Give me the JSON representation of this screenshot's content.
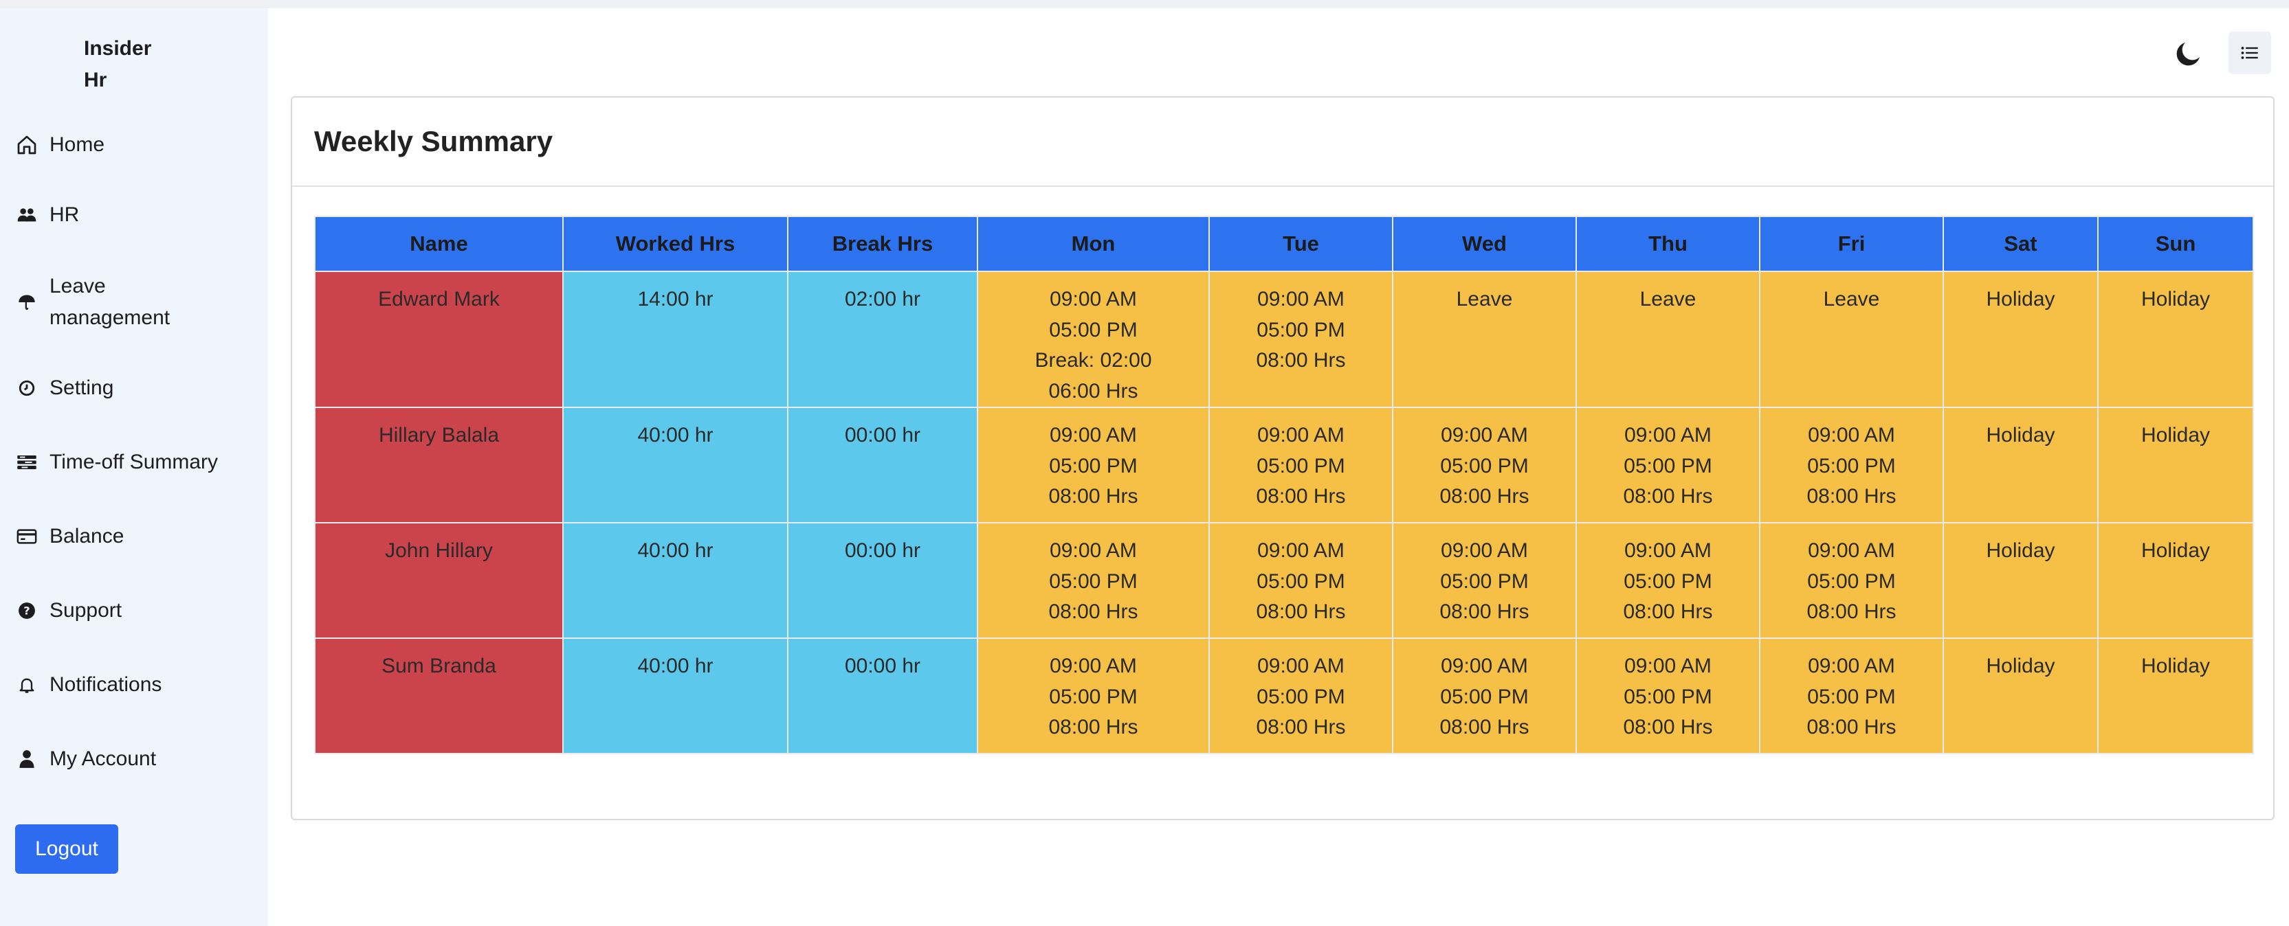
{
  "app": {
    "brand_line1": "Insider",
    "brand_line2": "Hr"
  },
  "sidebar": {
    "items": [
      {
        "label": "Home",
        "icon": "home-icon"
      },
      {
        "label": "HR",
        "icon": "users-icon"
      },
      {
        "label": "Leave management",
        "icon": "umbrella-icon"
      },
      {
        "label": "Setting",
        "icon": "clock-icon"
      },
      {
        "label": "Time-off Summary",
        "icon": "list-icon"
      },
      {
        "label": "Balance",
        "icon": "credit-card-icon"
      },
      {
        "label": "Support",
        "icon": "question-circle-icon"
      },
      {
        "label": "Notifications",
        "icon": "bell-icon"
      },
      {
        "label": "My Account",
        "icon": "user-icon"
      }
    ],
    "logout_label": "Logout"
  },
  "topbar": {
    "theme_icon": "moon-icon",
    "menu_icon": "list-menu-icon"
  },
  "card": {
    "title": "Weekly Summary"
  },
  "table": {
    "headers": [
      "Name",
      "Worked Hrs",
      "Break Hrs",
      "Mon",
      "Tue",
      "Wed",
      "Thu",
      "Fri",
      "Sat",
      "Sun"
    ],
    "rows": [
      {
        "name": "Edward Mark",
        "worked": "14:00 hr",
        "break": "02:00 hr",
        "days": [
          [
            "09:00 AM",
            "05:00 PM",
            "Break: 02:00",
            "06:00 Hrs"
          ],
          [
            "09:00 AM",
            "05:00 PM",
            "08:00 Hrs"
          ],
          [
            "Leave"
          ],
          [
            "Leave"
          ],
          [
            "Leave"
          ],
          [
            "Holiday"
          ],
          [
            "Holiday"
          ]
        ]
      },
      {
        "name": "Hillary Balala",
        "worked": "40:00 hr",
        "break": "00:00 hr",
        "days": [
          [
            "09:00 AM",
            "05:00 PM",
            "08:00 Hrs"
          ],
          [
            "09:00 AM",
            "05:00 PM",
            "08:00 Hrs"
          ],
          [
            "09:00 AM",
            "05:00 PM",
            "08:00 Hrs"
          ],
          [
            "09:00 AM",
            "05:00 PM",
            "08:00 Hrs"
          ],
          [
            "09:00 AM",
            "05:00 PM",
            "08:00 Hrs"
          ],
          [
            "Holiday"
          ],
          [
            "Holiday"
          ]
        ]
      },
      {
        "name": "John Hillary",
        "worked": "40:00 hr",
        "break": "00:00 hr",
        "days": [
          [
            "09:00 AM",
            "05:00 PM",
            "08:00 Hrs"
          ],
          [
            "09:00 AM",
            "05:00 PM",
            "08:00 Hrs"
          ],
          [
            "09:00 AM",
            "05:00 PM",
            "08:00 Hrs"
          ],
          [
            "09:00 AM",
            "05:00 PM",
            "08:00 Hrs"
          ],
          [
            "09:00 AM",
            "05:00 PM",
            "08:00 Hrs"
          ],
          [
            "Holiday"
          ],
          [
            "Holiday"
          ]
        ]
      },
      {
        "name": "Sum Branda",
        "worked": "40:00 hr",
        "break": "00:00 hr",
        "days": [
          [
            "09:00 AM",
            "05:00 PM",
            "08:00 Hrs"
          ],
          [
            "09:00 AM",
            "05:00 PM",
            "08:00 Hrs"
          ],
          [
            "09:00 AM",
            "05:00 PM",
            "08:00 Hrs"
          ],
          [
            "09:00 AM",
            "05:00 PM",
            "08:00 Hrs"
          ],
          [
            "09:00 AM",
            "05:00 PM",
            "08:00 Hrs"
          ],
          [
            "Holiday"
          ],
          [
            "Holiday"
          ]
        ]
      }
    ]
  },
  "colors": {
    "header_bg": "#2d73f0",
    "name_bg": "#cb434b",
    "hours_bg": "#5bc8ec",
    "day_bg": "#f6bf45",
    "logout_bg": "#2d6cf0",
    "sidebar_bg": "#f0f4fd"
  }
}
